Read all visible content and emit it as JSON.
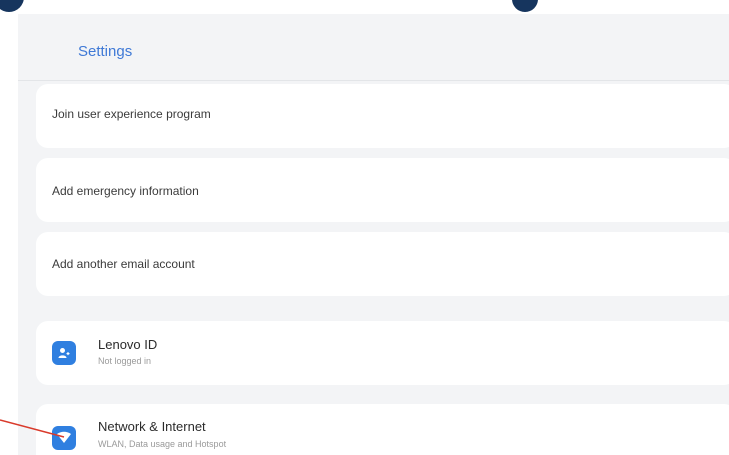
{
  "header": {
    "title": "Settings"
  },
  "settings": {
    "items": [
      {
        "label": "Join user experience program"
      },
      {
        "label": "Add emergency information"
      },
      {
        "label": "Add another email account"
      }
    ],
    "accounts": [
      {
        "title": "Lenovo ID",
        "subtitle": "Not logged in",
        "icon": "person-icon"
      },
      {
        "title": "Network & Internet",
        "subtitle": "WLAN, Data usage and Hotspot",
        "icon": "wifi-icon"
      }
    ]
  },
  "colors": {
    "accent": "#3f79d6",
    "icon_bg": "#2f7fe0",
    "annotation": "#d93a2b"
  }
}
